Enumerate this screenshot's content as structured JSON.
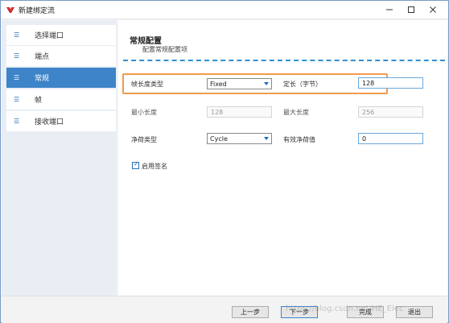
{
  "window": {
    "title": "新建绑定流"
  },
  "sidebar": {
    "items": [
      {
        "label": "选择端口"
      },
      {
        "label": "端点"
      },
      {
        "label": "常规"
      },
      {
        "label": "帧"
      },
      {
        "label": "接收端口"
      }
    ],
    "active_index": 2
  },
  "main": {
    "title": "常规配置",
    "subtitle": "配置常规配置项",
    "frame_length_type": {
      "label": "帧长度类型",
      "value": "Fixed"
    },
    "fixed_length": {
      "label": "定长（字节）",
      "value": "128"
    },
    "min_length": {
      "label": "最小长度",
      "value": "128"
    },
    "max_length": {
      "label": "最大长度",
      "value": "256"
    },
    "payload_type": {
      "label": "净荷类型",
      "value": "Cycle"
    },
    "payload_value": {
      "label": "有效净荷值",
      "value": "0"
    },
    "signature": {
      "label": "启用签名",
      "checked": true
    }
  },
  "footer": {
    "prev": "上一步",
    "next": "下一步",
    "finish": "完成",
    "exit": "退出"
  },
  "watermark": "https://blog.csdn.net/HE_Elec",
  "colors": {
    "accent": "#3d84c9",
    "highlight": "#f29a4e",
    "divider": "#2f8fd0"
  }
}
